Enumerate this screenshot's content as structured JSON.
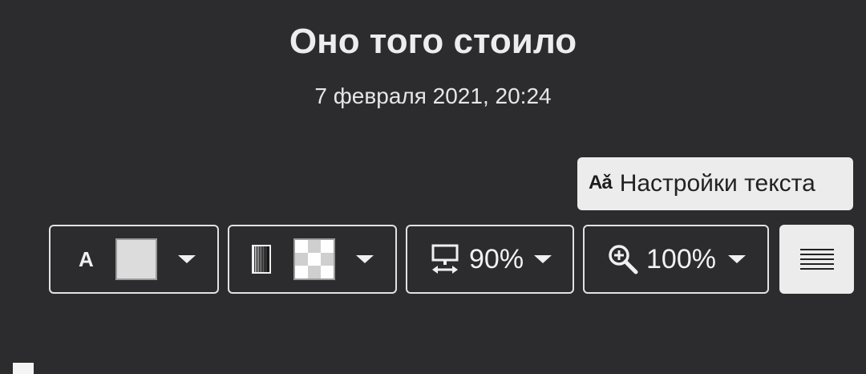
{
  "article": {
    "title": "Оно того стоило",
    "date": "7 февраля 2021, 20:24"
  },
  "toolbar": {
    "text_settings_icon": "Aǎ",
    "text_settings_label": "Настройки текста",
    "font_color": {
      "letter": "A",
      "swatch_color": "#dcdcdc"
    },
    "background": {
      "swatch": "transparent"
    },
    "width": {
      "value": "90%"
    },
    "zoom": {
      "value": "100%"
    },
    "alignment": "justify"
  },
  "colors": {
    "page_background": "#2c2c2e",
    "button_light": "#ececec",
    "border": "#e2e2e2"
  }
}
